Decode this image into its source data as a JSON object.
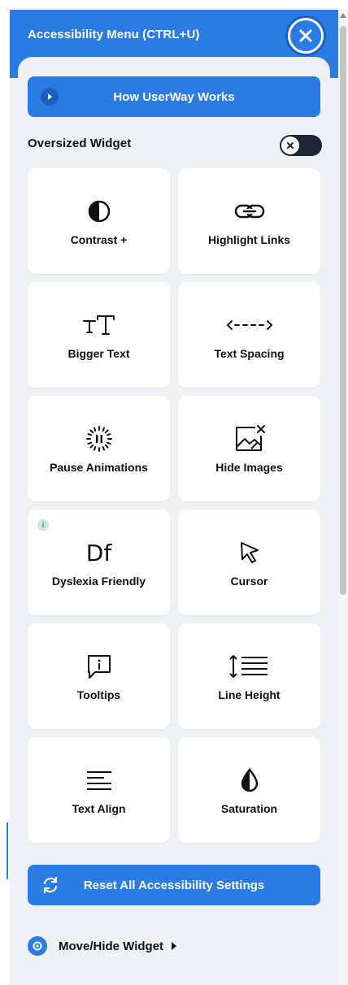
{
  "header": {
    "title": "Accessibility Menu (CTRL+U)"
  },
  "how_button": {
    "label": "How UserWay Works"
  },
  "oversized": {
    "label": "Oversized Widget",
    "enabled": false
  },
  "tiles": [
    {
      "label": "Contrast +",
      "icon": "contrast-icon"
    },
    {
      "label": "Highlight Links",
      "icon": "link-icon"
    },
    {
      "label": "Bigger Text",
      "icon": "text-size-icon"
    },
    {
      "label": "Text Spacing",
      "icon": "spacing-arrows-icon"
    },
    {
      "label": "Pause Animations",
      "icon": "pause-icon"
    },
    {
      "label": "Hide Images",
      "icon": "hide-image-icon"
    },
    {
      "label": "Dyslexia Friendly",
      "icon": "dyslexia-icon",
      "glyph": "Df",
      "info": "i"
    },
    {
      "label": "Cursor",
      "icon": "cursor-icon"
    },
    {
      "label": "Tooltips",
      "icon": "tooltip-icon"
    },
    {
      "label": "Line Height",
      "icon": "line-height-icon"
    },
    {
      "label": "Text Align",
      "icon": "text-align-icon"
    },
    {
      "label": "Saturation",
      "icon": "saturation-icon"
    }
  ],
  "reset_button": {
    "label": "Reset All Accessibility Settings"
  },
  "move_widget": {
    "label": "Move/Hide Widget"
  },
  "colors": {
    "accent": "#2b7be4",
    "panel_bg": "#eef1f5",
    "toggle_off": "#1c2536"
  }
}
